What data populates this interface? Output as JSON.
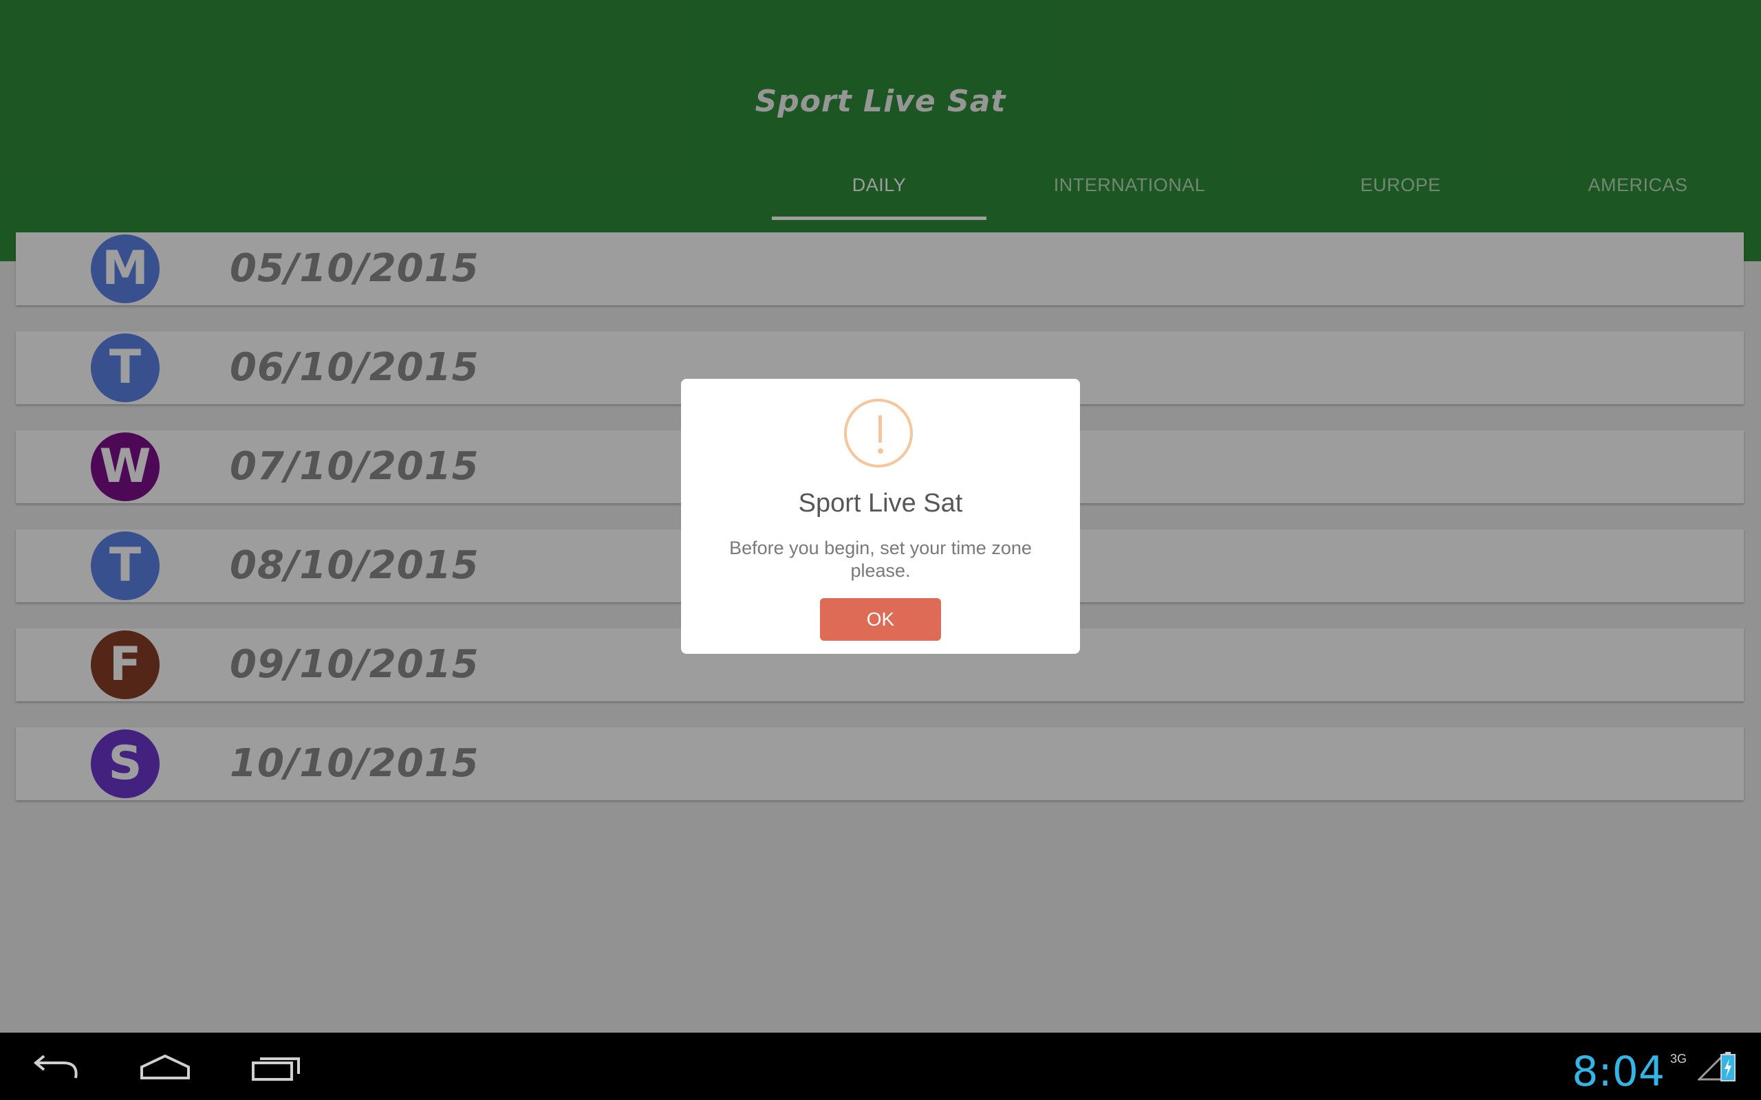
{
  "app": {
    "title": "Sport Live Sat"
  },
  "tabs": [
    {
      "label": "DAILY",
      "active": true
    },
    {
      "label": "INTERNATIONAL",
      "active": false
    },
    {
      "label": "EUROPE",
      "active": false
    },
    {
      "label": "AMERICAS",
      "active": false
    }
  ],
  "days": [
    {
      "letter": "M",
      "date": "05/10/2015",
      "color": "#5b82e6"
    },
    {
      "letter": "T",
      "date": "06/10/2015",
      "color": "#5b82e6"
    },
    {
      "letter": "W",
      "date": "07/10/2015",
      "color": "#7d0f8c"
    },
    {
      "letter": "T",
      "date": "08/10/2015",
      "color": "#5b82e6"
    },
    {
      "letter": "F",
      "date": "09/10/2015",
      "color": "#873e27"
    },
    {
      "letter": "S",
      "date": "10/10/2015",
      "color": "#6b37cc"
    }
  ],
  "dialog": {
    "icon": "warning-icon",
    "title": "Sport Live Sat",
    "message": "Before you begin, set your time zone please.",
    "ok_label": "OK"
  },
  "system": {
    "time": "8:04",
    "network": "3G"
  },
  "colors": {
    "appbar": "#2e8b38",
    "button": "#dd6b55",
    "clock": "#33b5e5"
  }
}
